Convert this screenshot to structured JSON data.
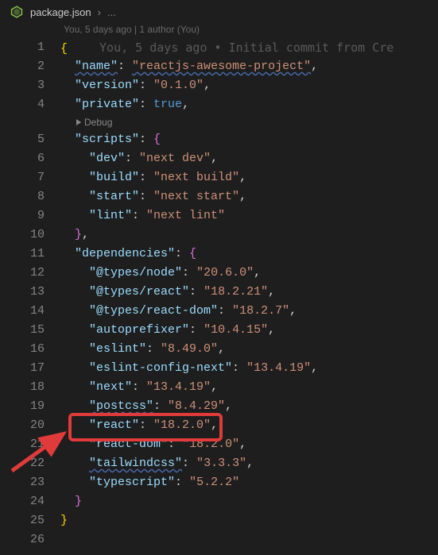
{
  "tab": {
    "filename": "package.json",
    "crumb_more": "..."
  },
  "blame_line": "You, 5 days ago | 1 author (You)",
  "inline_blame": "You, 5 days ago • Initial commit from Cre",
  "codelens_debug": "Debug",
  "json": {
    "name_key": "\"name\"",
    "name_val": "\"reactjs-awesome-project\"",
    "version_key": "\"version\"",
    "version_val": "\"0.1.0\"",
    "private_key": "\"private\"",
    "private_val": "true",
    "scripts_key": "\"scripts\"",
    "dev_key": "\"dev\"",
    "dev_val": "\"next dev\"",
    "build_key": "\"build\"",
    "build_val": "\"next build\"",
    "start_key": "\"start\"",
    "start_val": "\"next start\"",
    "lint_key": "\"lint\"",
    "lint_val": "\"next lint\"",
    "deps_key": "\"dependencies\"",
    "types_node_key": "\"@types/node\"",
    "types_node_val": "\"20.6.0\"",
    "types_react_key": "\"@types/react\"",
    "types_react_val": "\"18.2.21\"",
    "types_react_dom_key": "\"@types/react-dom\"",
    "types_react_dom_val": "\"18.2.7\"",
    "autoprefixer_key": "\"autoprefixer\"",
    "autoprefixer_val": "\"10.4.15\"",
    "eslint_key": "\"eslint\"",
    "eslint_val": "\"8.49.0\"",
    "eslint_cfg_key": "\"eslint-config-next\"",
    "eslint_cfg_val": "\"13.4.19\"",
    "next_key": "\"next\"",
    "next_val": "\"13.4.19\"",
    "postcss_key": "\"postcss\"",
    "postcss_val": "\"8.4.29\"",
    "react_key": "\"react\"",
    "react_val": "\"18.2.0\"",
    "react_dom_key": "\"react-dom\"",
    "react_dom_val": "\"18.2.0\"",
    "tailwind_key": "\"tailwindcss\"",
    "tailwind_val": "\"3.3.3\"",
    "ts_key": "\"typescript\"",
    "ts_val": "\"5.2.2\""
  },
  "line_numbers": [
    "1",
    "2",
    "3",
    "4",
    "5",
    "6",
    "7",
    "8",
    "9",
    "10",
    "11",
    "12",
    "13",
    "14",
    "15",
    "16",
    "17",
    "18",
    "19",
    "20",
    "21",
    "22",
    "23",
    "24",
    "25",
    "26"
  ]
}
